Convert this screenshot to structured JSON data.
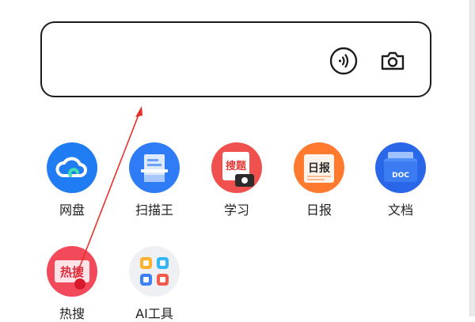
{
  "search": {
    "placeholder": "",
    "voice_icon": "voice-wave-icon",
    "camera_icon": "camera-icon"
  },
  "apps": [
    {
      "key": "netdisk",
      "label": "网盘",
      "icon": "cloud-drive-icon",
      "color": "#1f7cf3"
    },
    {
      "key": "scanner",
      "label": "扫描王",
      "icon": "scanner-icon",
      "color": "#2f7cf6"
    },
    {
      "key": "study",
      "label": "学习",
      "icon": "search-question-icon",
      "badge": "搜题",
      "color": "#f0514e"
    },
    {
      "key": "daily",
      "label": "日报",
      "icon": "newspaper-icon",
      "badge": "日报",
      "color": "#ff7a2f"
    },
    {
      "key": "docs",
      "label": "文档",
      "icon": "doc-folder-icon",
      "badge": "DOC",
      "color": "#2a67e8"
    },
    {
      "key": "hotsearch",
      "label": "热搜",
      "icon": "hot-search-icon",
      "badge": "热搜",
      "color": "#f24a5a"
    },
    {
      "key": "aitools",
      "label": "AI工具",
      "icon": "ai-tools-icon",
      "color": "#eef0f4"
    }
  ],
  "annotation": {
    "type": "arrow",
    "color": "#e8302a"
  }
}
